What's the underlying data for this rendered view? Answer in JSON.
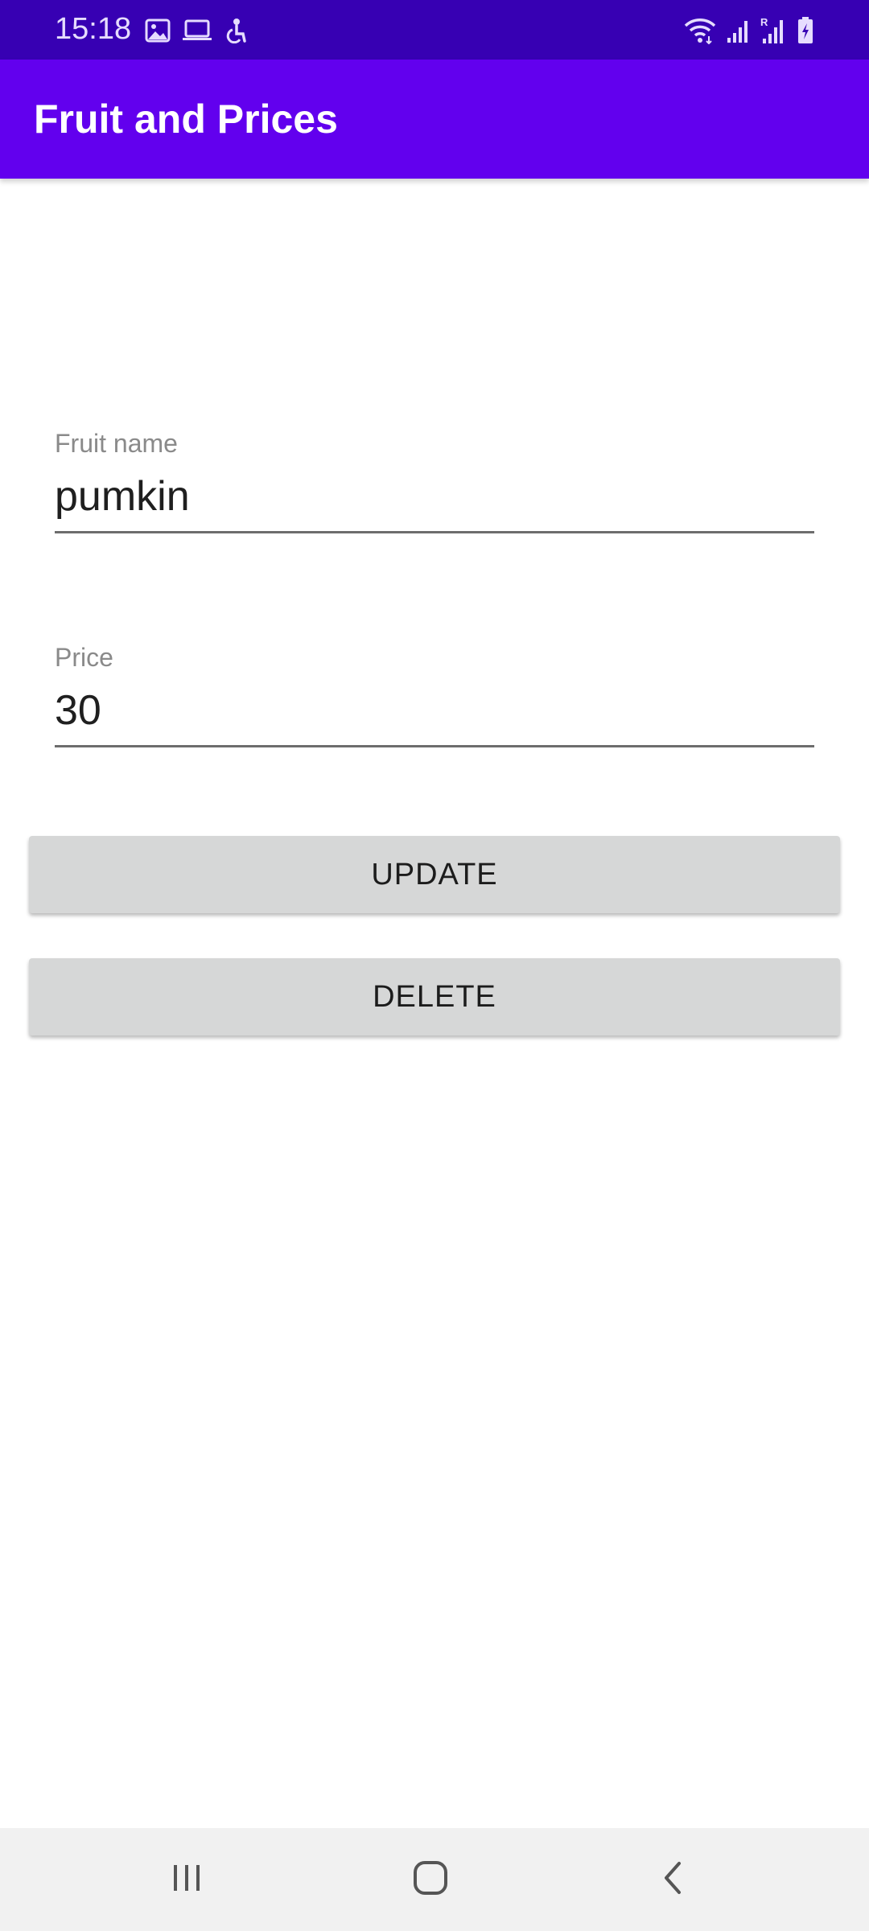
{
  "status_bar": {
    "time": "15:18",
    "left_icons": [
      "image-icon",
      "laptop-icon",
      "accessibility-icon"
    ],
    "right_icons": [
      "wifi-icon",
      "signal-icon",
      "signal-roaming-icon",
      "battery-charging-icon"
    ],
    "roaming_indicator": "R",
    "background_color": "#3700b3"
  },
  "app_bar": {
    "title": "Fruit and Prices",
    "background_color": "#6200ee"
  },
  "form": {
    "fruit_name": {
      "label": "Fruit name",
      "value": "pumkin"
    },
    "price": {
      "label": "Price",
      "value": "30"
    }
  },
  "buttons": {
    "update_label": "UPDATE",
    "delete_label": "DELETE"
  },
  "nav_bar": {
    "icons": [
      "recents-icon",
      "home-icon",
      "back-icon"
    ]
  }
}
